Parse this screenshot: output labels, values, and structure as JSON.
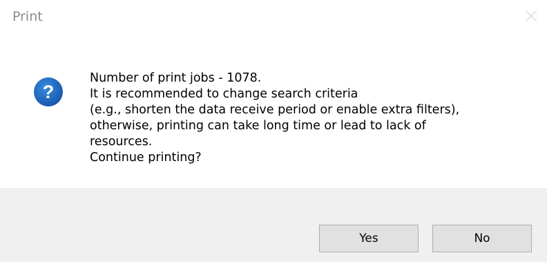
{
  "window": {
    "title": "Print"
  },
  "icons": {
    "close": "close-icon",
    "question": "question-icon",
    "question_color": "#1e6fc4"
  },
  "message": {
    "lines": [
      "Number of print jobs - 1078.",
      "It is recommended to change search criteria",
      "(e.g., shorten the data receive period or enable extra filters),",
      "otherwise, printing can take long time or lead to lack of",
      "resources.",
      "Continue printing?"
    ]
  },
  "buttons": {
    "yes_label": "Yes",
    "no_label": "No"
  }
}
